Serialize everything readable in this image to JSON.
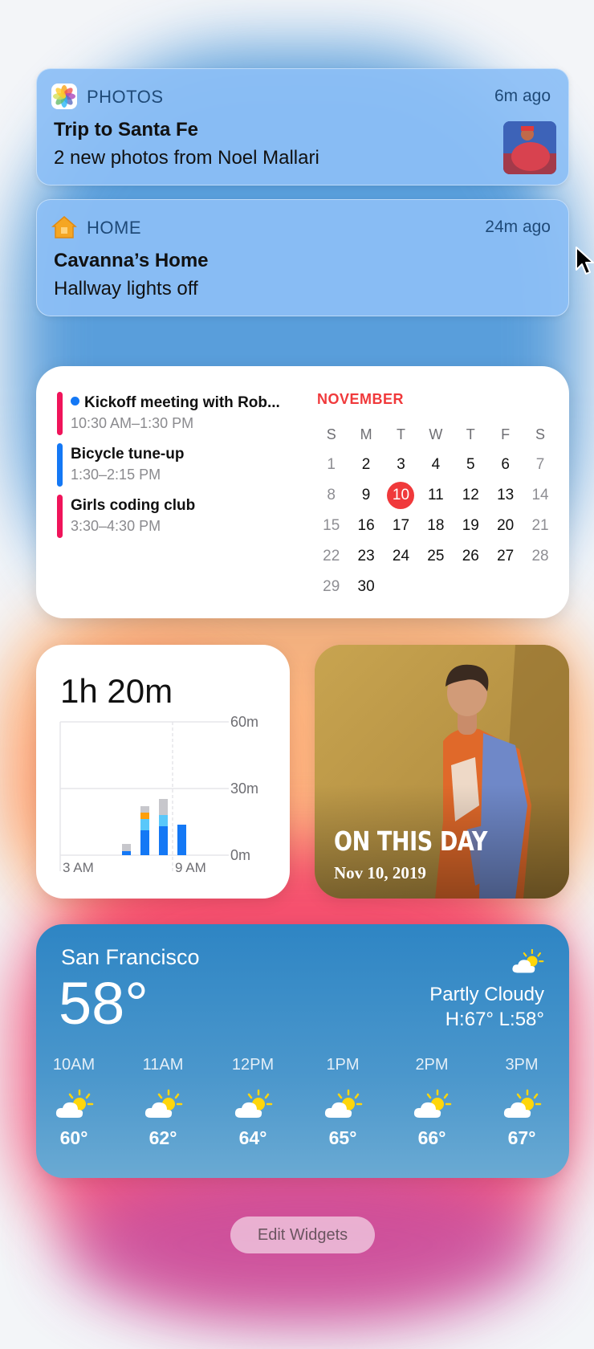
{
  "notifications": [
    {
      "app": "PHOTOS",
      "time": "6m ago",
      "title": "Trip to Santa Fe",
      "body": "2 new photos from Noel Mallari",
      "icon": "photos-icon"
    },
    {
      "app": "HOME",
      "time": "24m ago",
      "title": "Cavanna’s Home",
      "body": "Hallway lights off",
      "icon": "home-icon"
    }
  ],
  "calendar": {
    "month": "NOVEMBER",
    "weekdays": [
      "S",
      "M",
      "T",
      "W",
      "T",
      "F",
      "S"
    ],
    "weeks": [
      [
        "1",
        "2",
        "3",
        "4",
        "5",
        "6",
        "7"
      ],
      [
        "8",
        "9",
        "10",
        "11",
        "12",
        "13",
        "14"
      ],
      [
        "15",
        "16",
        "17",
        "18",
        "19",
        "20",
        "21"
      ],
      [
        "22",
        "23",
        "24",
        "25",
        "26",
        "27",
        "28"
      ],
      [
        "29",
        "30",
        "",
        "",
        "",
        "",
        ""
      ]
    ],
    "today": "10",
    "events": [
      {
        "title": "Kickoff meeting with Rob...",
        "time": "10:30 AM–1:30 PM",
        "color": "#f0145a",
        "dot": true
      },
      {
        "title": "Bicycle tune-up",
        "time": "1:30–2:15 PM",
        "color": "#1478f5",
        "dot": false
      },
      {
        "title": "Girls coding club",
        "time": "3:30–4:30 PM",
        "color": "#f0145a",
        "dot": false
      }
    ]
  },
  "screen_time": {
    "total": "1h 20m",
    "y_labels": [
      "60m",
      "30m",
      "0m"
    ],
    "x_labels": [
      "3 AM",
      "9 AM"
    ]
  },
  "photo_memory": {
    "title": "ON THIS DAY",
    "date": "Nov 10, 2019"
  },
  "weather": {
    "city": "San Francisco",
    "temp": "58°",
    "condition": "Partly Cloudy",
    "high_low": "H:67° L:58°",
    "icon": "partly-sunny-icon",
    "hourly": [
      {
        "hour": "10AM",
        "temp": "60°"
      },
      {
        "hour": "11AM",
        "temp": "62°"
      },
      {
        "hour": "12PM",
        "temp": "64°"
      },
      {
        "hour": "1PM",
        "temp": "65°"
      },
      {
        "hour": "2PM",
        "temp": "66°"
      },
      {
        "hour": "3PM",
        "temp": "67°"
      }
    ]
  },
  "edit_widgets_label": "Edit Widgets"
}
